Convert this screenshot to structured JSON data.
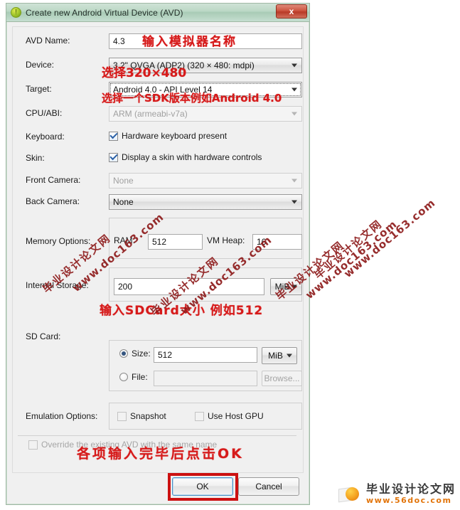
{
  "window": {
    "title": "Create new Android Virtual Device (AVD)",
    "icon": "android-avd-icon",
    "close_label": "x"
  },
  "form": {
    "avd_name": {
      "label": "AVD Name:",
      "value": "4.3"
    },
    "device": {
      "label": "Device:",
      "value": "3.2\" QVGA (ADP2) (320 × 480: mdpi)"
    },
    "target": {
      "label": "Target:",
      "value": "Android 4.0 - API Level 14"
    },
    "cpu_abi": {
      "label": "CPU/ABI:",
      "value": "ARM (armeabi-v7a)"
    },
    "keyboard": {
      "label": "Keyboard:",
      "checkbox_label": "Hardware keyboard present",
      "checked": true
    },
    "skin": {
      "label": "Skin:",
      "checkbox_label": "Display a skin with hardware controls",
      "checked": true
    },
    "front_camera": {
      "label": "Front Camera:",
      "value": "None"
    },
    "back_camera": {
      "label": "Back Camera:",
      "value": "None"
    },
    "memory_options": {
      "label": "Memory Options:",
      "ram_label": "RAM:",
      "ram_value": "512",
      "vmheap_label": "VM Heap:",
      "vmheap_value": "16"
    },
    "internal_storage": {
      "label": "Internal Storage:",
      "value": "200",
      "unit": "MiB"
    },
    "sd_card": {
      "label": "SD Card:",
      "size_label": "Size:",
      "size_value": "512",
      "size_unit": "MiB",
      "size_selected": true,
      "file_label": "File:",
      "file_value": "",
      "browse_label": "Browse...",
      "file_selected": false
    },
    "emulation_options": {
      "label": "Emulation Options:",
      "snapshot_label": "Snapshot",
      "snapshot_checked": false,
      "host_gpu_label": "Use Host GPU",
      "host_gpu_checked": false
    },
    "override": {
      "label": "Override the existing AVD with the same name",
      "checked": false,
      "disabled": true
    }
  },
  "buttons": {
    "ok": "OK",
    "cancel": "Cancel"
  },
  "annotations": {
    "avd_name": "输入模拟器名称",
    "device": "选择320×480",
    "target": "选择一个SDK版本例如Android 4.0",
    "sd_card": "输入SDCard大小    例如512",
    "ok": "各项输入完毕后点击OK"
  },
  "watermarks": {
    "cn": "毕业设计论文网",
    "url": "www.doc163.com"
  },
  "logo": {
    "cn": "毕业设计论文网",
    "url": "www.56doc.com"
  },
  "colors": {
    "annotation_red": "#d61a1a",
    "watermark_red": "#8e1b1b",
    "highlight_box_red": "#cc1111",
    "title_green": "#bcd8c6",
    "close_red": "#cc5540",
    "logo_orange": "#e2740a"
  }
}
